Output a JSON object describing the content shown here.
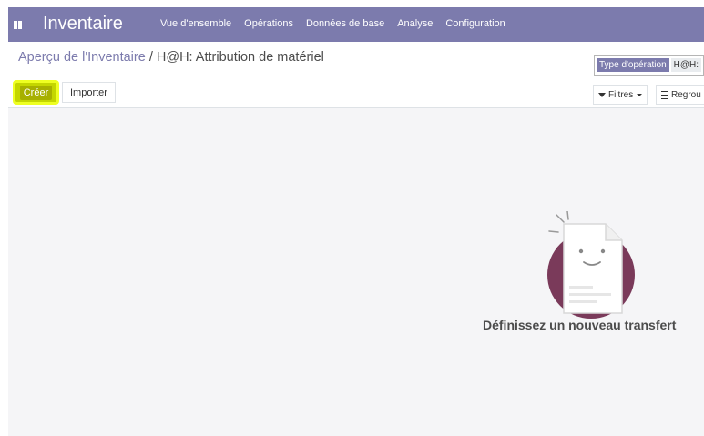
{
  "navbar": {
    "app_title": "Inventaire",
    "menu": [
      "Vue d'ensemble",
      "Opérations",
      "Données de base",
      "Analyse",
      "Configuration"
    ],
    "background": "#7c7bad"
  },
  "breadcrumb": {
    "parent": "Aperçu de l'Inventaire",
    "separator": " / ",
    "current": "H@H: Attribution de matériel"
  },
  "buttons": {
    "create": "Créer",
    "import": "Importer"
  },
  "search": {
    "facet_label": "Type d'opération",
    "facet_value": "H@H:"
  },
  "filters": {
    "filters_label": "Filtres",
    "group_label": "Regrou"
  },
  "empty_state": {
    "title": "Définissez un nouveau transfert"
  },
  "colors": {
    "accent": "#7c7bad",
    "create_button": "#c4d600",
    "highlight": "#eeff22"
  },
  "icons": [
    "apps-icon",
    "funnel-icon",
    "caret-down-icon",
    "bars-icon",
    "empty-document-illustration"
  ]
}
